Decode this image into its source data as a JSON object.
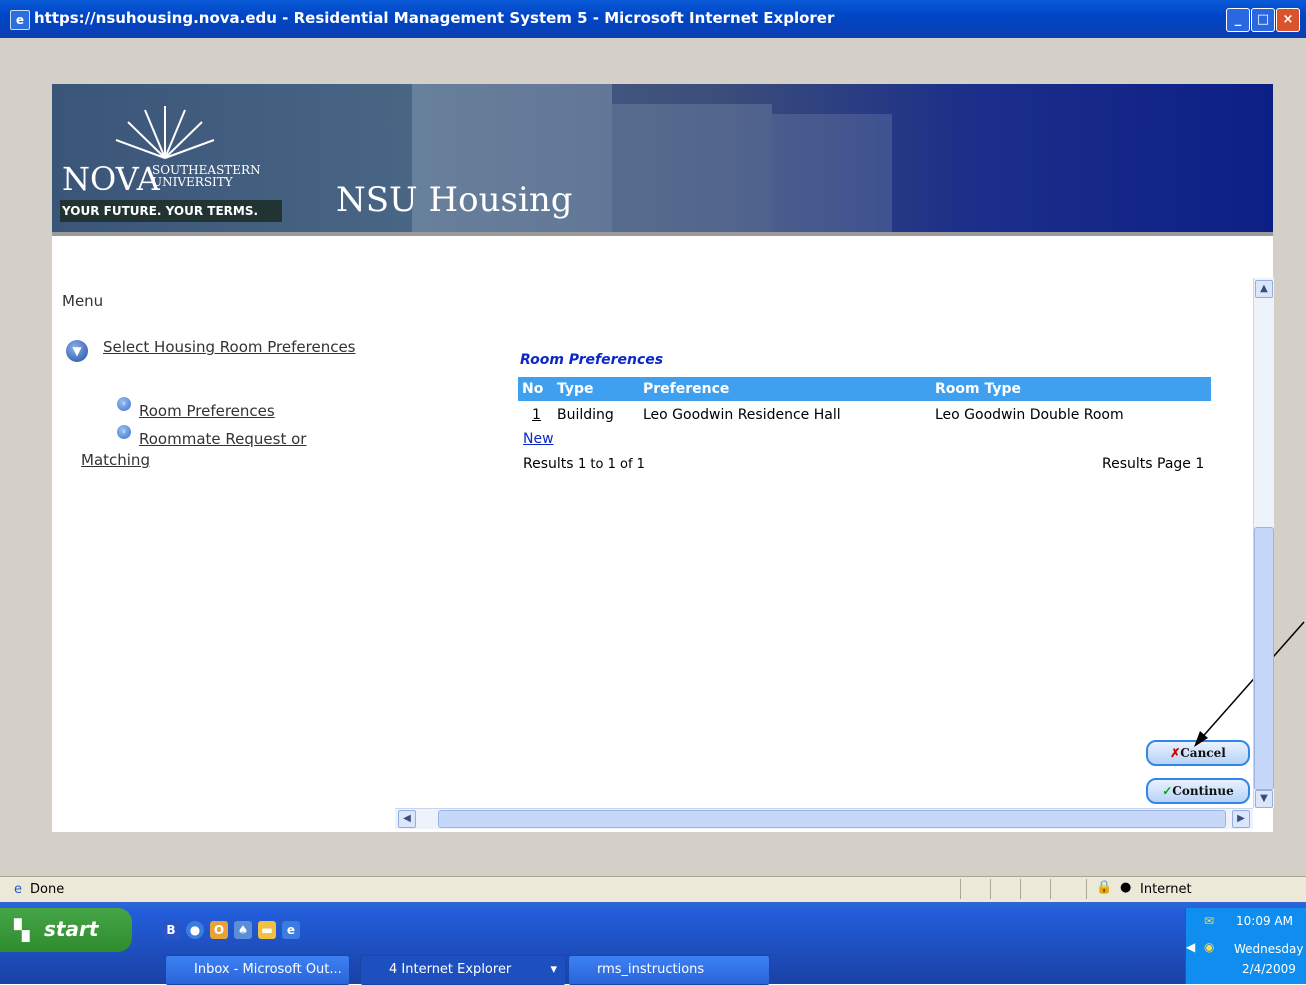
{
  "window": {
    "title": "https://nsuhousing.nova.edu - Residential Management System 5 - Microsoft Internet Explorer",
    "controls": [
      "minimize",
      "maximize",
      "close"
    ]
  },
  "banner": {
    "logo_main": "NOVA",
    "logo_line1": "SOUTHEASTERN",
    "logo_line2": "UNIVERSITY",
    "tagline": "YOUR FUTURE. YOUR TERMS.",
    "site_title": "NSU Housing"
  },
  "menu": {
    "heading": "Menu",
    "section_link": "Select Housing Room Preferences",
    "sub_items": [
      {
        "label": "Room Preferences"
      },
      {
        "label_line1": "Roommate Request or",
        "label_line2": "Matching"
      }
    ]
  },
  "room_preferences": {
    "title": "Room Preferences",
    "columns": [
      "No",
      "Type",
      "Preference",
      "Room Type"
    ],
    "rows": [
      {
        "no": "1",
        "type": "Building",
        "preference": "Leo Goodwin Residence Hall",
        "room_type": "Leo Goodwin Double Room"
      }
    ],
    "new_link": "New",
    "results_text": "Results",
    "results_range": "1 to 1 of 1",
    "results_page": "Results Page 1"
  },
  "actions": {
    "cancel": "Cancel",
    "continue": "Continue"
  },
  "statusbar": {
    "status": "Done",
    "zone": "Internet"
  },
  "taskbar": {
    "start": "start",
    "tasks": [
      "Inbox - Microsoft Out...",
      "4 Internet Explorer",
      "rms_instructions"
    ],
    "time": "10:09 AM",
    "day": "Wednesday",
    "date": "2/4/2009"
  },
  "colors": {
    "title_bar": "#0046c7",
    "grid_header": "#3fa0f0",
    "link_blue": "#0a28c8",
    "banner_dark": "#0c1f86",
    "taskbar": "#245edb",
    "start_green": "#2f8c2f"
  }
}
